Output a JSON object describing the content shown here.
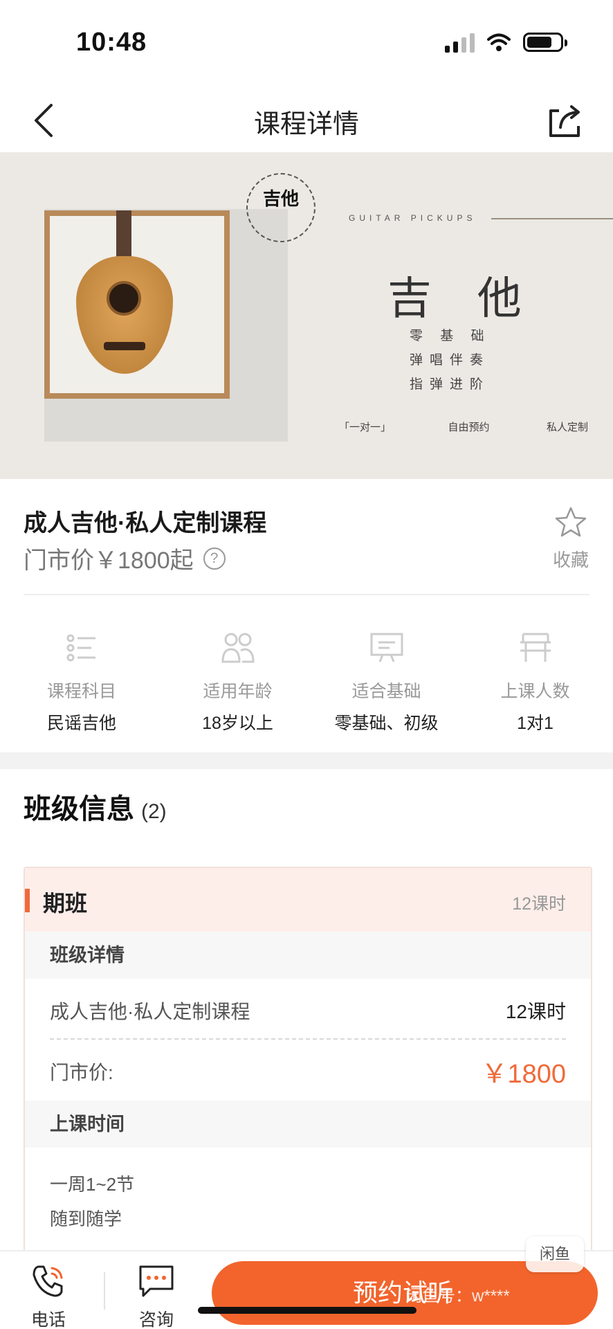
{
  "status_bar": {
    "time": "10:48"
  },
  "nav": {
    "title": "课程详情"
  },
  "banner": {
    "logo_text": "吉他",
    "sub_brand": "GUITAR PICKUPS",
    "title": "吉 他",
    "lines": [
      "零 基 础",
      "弹唱伴奏",
      "指弹进阶"
    ],
    "tags": [
      "「一对一」",
      "自由预约",
      "私人定制"
    ]
  },
  "course": {
    "title": "成人吉他·私人定制课程",
    "price_text": "门市价￥1800起",
    "help": "?",
    "favorite_label": "收藏"
  },
  "info": [
    {
      "label": "课程科目",
      "value": "民谣吉他",
      "icon": "list-icon"
    },
    {
      "label": "适用年龄",
      "value": "18岁以上",
      "icon": "people-icon"
    },
    {
      "label": "适合基础",
      "value": "零基础、初级",
      "icon": "board-icon"
    },
    {
      "label": "上课人数",
      "value": "1对1",
      "icon": "desk-icon"
    }
  ],
  "class_section": {
    "title": "班级信息",
    "count": "(2)",
    "card": {
      "name": "期班",
      "hours": "12课时",
      "detail_header": "班级详情",
      "course_name": "成人吉他·私人定制课程",
      "course_hours": "12课时",
      "price_label": "门市价:",
      "price_value": "￥1800",
      "time_header": "上课时间",
      "schedule": [
        "一周1~2节",
        "随到随学"
      ]
    }
  },
  "bottom_bar": {
    "phone_label": "电话",
    "consult_label": "咨询",
    "cta_label": "预约试听",
    "watermark_badge": "闲鱼",
    "watermark_text": "闲鱼号：w****"
  },
  "colors": {
    "accent": "#f2642c",
    "price": "#f06a3a"
  }
}
